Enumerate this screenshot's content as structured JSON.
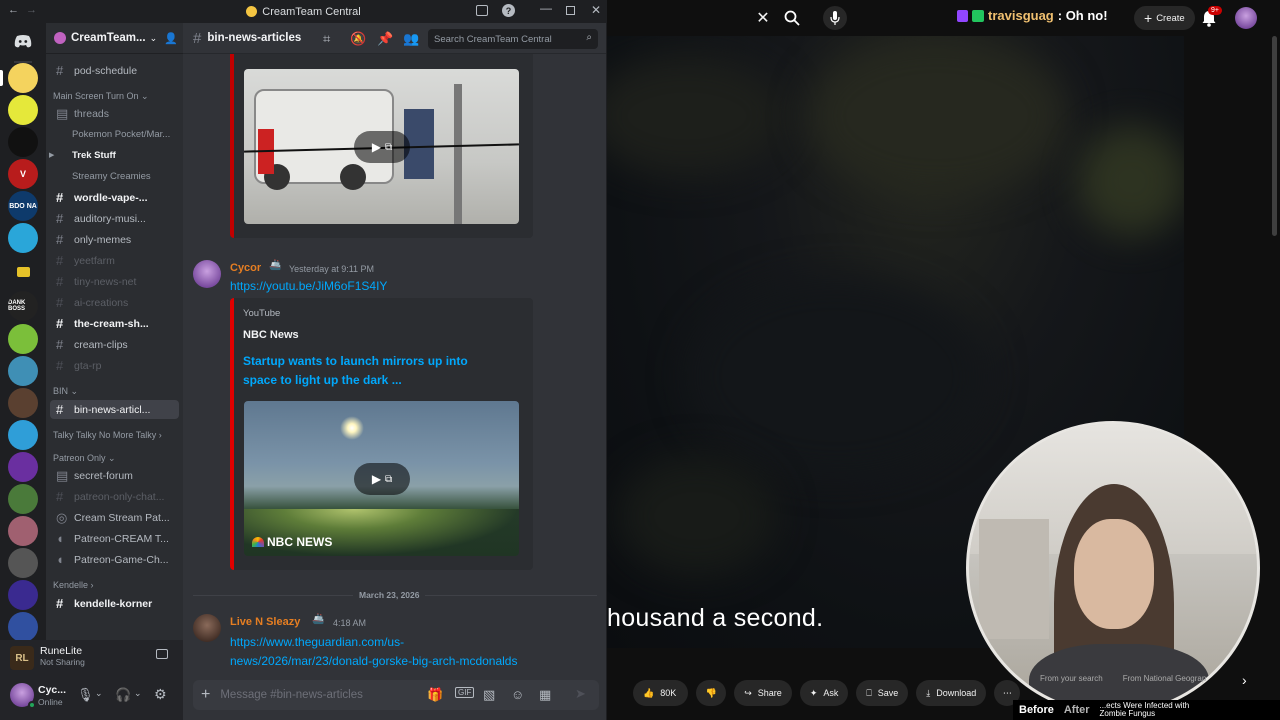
{
  "colors": {
    "discord_bg": "#313338",
    "discord_sidebar": "#2b2d31",
    "discord_dark": "#1e1f22",
    "youtube_red": "#e00000",
    "link": "#00a8fc",
    "active_channel": "#404249"
  },
  "discord": {
    "window_title": "CreamTeam Central",
    "server_name": "CreamTeam...",
    "current_channel": "bin-news-articles",
    "search_placeholder": "Search CreamTeam Central",
    "channels": {
      "pod_schedule": "pod-schedule",
      "cat_main": "Main Screen Turn On",
      "threads": "threads",
      "thread_pokemon": "Pokemon Pocket/Mar...",
      "thread_trek": "Trek Stuff",
      "thread_streamy": "Streamy Creamies",
      "wordle": "wordle-vape-...",
      "auditory": "auditory-musi...",
      "only_memes": "only-memes",
      "yeetfarm": "yeetfarm",
      "tiny_news": "tiny-news-net",
      "ai_creations": "ai-creations",
      "cream_sh": "the-cream-sh...",
      "cream_clips": "cream-clips",
      "gta_rp": "gta-rp",
      "cat_bin": "BIN",
      "bin_news": "bin-news-articl...",
      "cat_talky": "Talky Talky No More Talky",
      "cat_patreon": "Patreon Only",
      "secret_forum": "secret-forum",
      "patreon_chat": "patreon-only-chat...",
      "cream_stream": "Cream Stream Pat...",
      "patreon_cream": "Patreon-CREAM T...",
      "patreon_game": "Patreon-Game-Ch...",
      "cat_kendelle": "Kendelle",
      "kendelle_korner": "kendelle-korner"
    },
    "voice": {
      "title": "RuneLite",
      "status": "Not Sharing"
    },
    "user": {
      "name": "Cyc...",
      "status": "Online"
    },
    "messages": {
      "m1": {
        "author": "Cycor",
        "badge": "🚢",
        "time": "Yesterday at 9:11 PM",
        "link": "https://youtu.be/JiM6oF1S4IY",
        "provider": "YouTube",
        "channel": "NBC News",
        "title_line1": "Startup wants to launch mirrors up into",
        "title_line2": "space to light up the dark ...",
        "watermark": "NBC NEWS"
      },
      "date_divider": "March 23, 2026",
      "m2": {
        "author": "Live N Sleazy",
        "badge": "🚢",
        "time": "4:18 AM",
        "link_line1": "https://www.theguardian.com/us-",
        "link_line2": "news/2026/mar/23/donald-gorske-big-arch-mcdonalds"
      }
    },
    "composer_placeholder": "Message #bin-news-articles"
  },
  "youtube": {
    "chat_user": "travisguag",
    "chat_message": ": Oh no!",
    "create_label": "Create",
    "notif_badge": "9+",
    "caption": "housand a second.",
    "likes": "80K",
    "share": "Share",
    "ask": "Ask",
    "save": "Save",
    "download": "Download",
    "chip1": "From your search",
    "chip2": "From National Geograp",
    "before": "Before",
    "after": "After",
    "up_next": "...ects Were Infected with",
    "up_next2": "Zombie Fungus"
  }
}
